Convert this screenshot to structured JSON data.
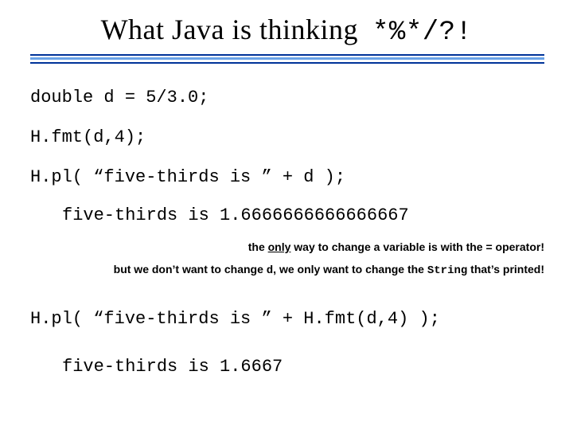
{
  "title": {
    "text": "What Java is thinking",
    "symbols": "*%*/?!"
  },
  "code": {
    "line1": "double d = 5/3.0;",
    "line2": "H.fmt(d,4);",
    "line3_pre": "H.pl( ",
    "line3_str": "“five-thirds is ”",
    "line3_post": " + d );",
    "output1": "five-thirds is 1.6666666666666667",
    "line4_pre": "H.pl( ",
    "line4_str": "“five-thirds is ”",
    "line4_mid": " + ",
    "line4_call": "H.fmt(d,4)",
    "line4_post": " );",
    "output2": "five-thirds is 1.6667"
  },
  "notes": {
    "n1_a": "the ",
    "n1_b": "only",
    "n1_c": " way to change a variable is with the = operator!",
    "n2_a": "but we don’t want to change ",
    "n2_b": "d",
    "n2_c": ", we only want to change the ",
    "n2_d": "String",
    "n2_e": " that’s printed!"
  }
}
